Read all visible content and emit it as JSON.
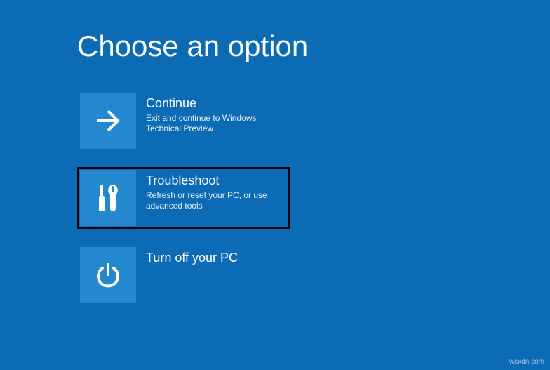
{
  "screen": {
    "title": "Choose an option"
  },
  "options": [
    {
      "title": "Continue",
      "description": "Exit and continue to Windows Technical Preview",
      "icon": "arrow-right-icon"
    },
    {
      "title": "Troubleshoot",
      "description": "Refresh or reset your PC, or use advanced tools",
      "icon": "tools-icon",
      "highlighted": true
    },
    {
      "title": "Turn off your PC",
      "description": "",
      "icon": "power-icon"
    }
  ],
  "watermark": "wsxdn.com"
}
